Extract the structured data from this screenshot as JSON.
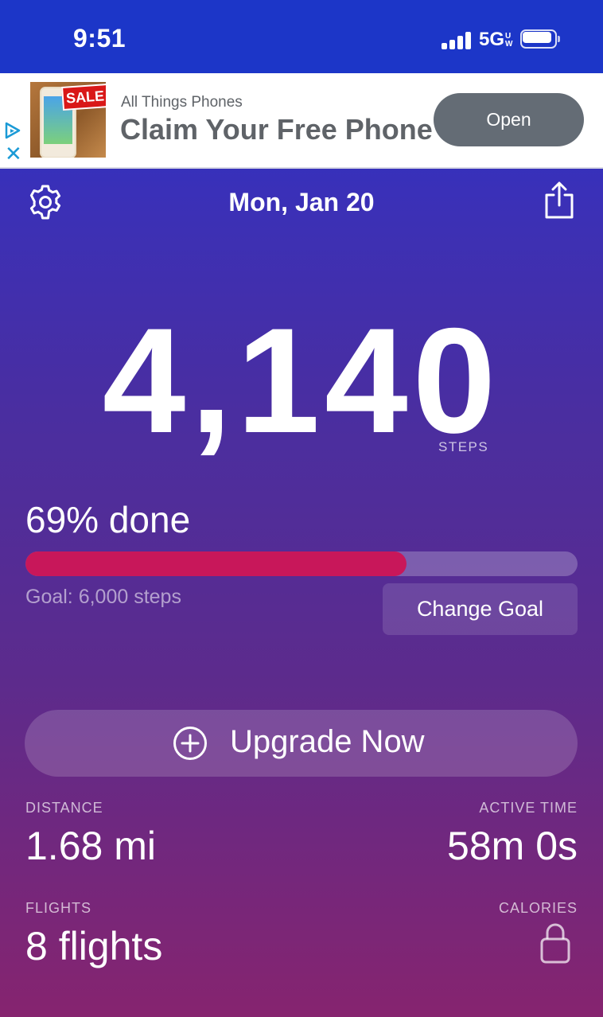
{
  "status_bar": {
    "time": "9:51",
    "network": "5G",
    "network_suffix": "UW"
  },
  "ad": {
    "advertiser": "All Things Phones",
    "headline": "Claim Your Free Phone",
    "open_label": "Open",
    "image_badge": "SALE",
    "close_icon": "close-icon",
    "adchoices_icon": "adchoices-icon"
  },
  "header": {
    "date": "Mon, Jan 20",
    "settings_icon": "gear-icon",
    "share_icon": "share-icon"
  },
  "steps": {
    "count": "4,140",
    "unit": "STEPS"
  },
  "progress": {
    "label": "69% done",
    "fraction": 0.69,
    "goal": "Goal: 6,000 steps",
    "change_goal": "Change Goal",
    "fill_color": "#c8175a"
  },
  "upgrade": {
    "label": "Upgrade Now",
    "icon": "plus-circle-icon"
  },
  "stats": {
    "distance_label": "DISTANCE",
    "distance_value": "1.68 mi",
    "active_label": "ACTIVE TIME",
    "active_value": "58m 0s",
    "flights_label": "FLIGHTS",
    "flights_value": "8 flights",
    "calories_label": "CALORIES",
    "calories_icon": "lock-icon"
  },
  "colors": {
    "status_bar": "#1c36c8",
    "ad_button": "#646c75",
    "accent": "#c8175a"
  }
}
